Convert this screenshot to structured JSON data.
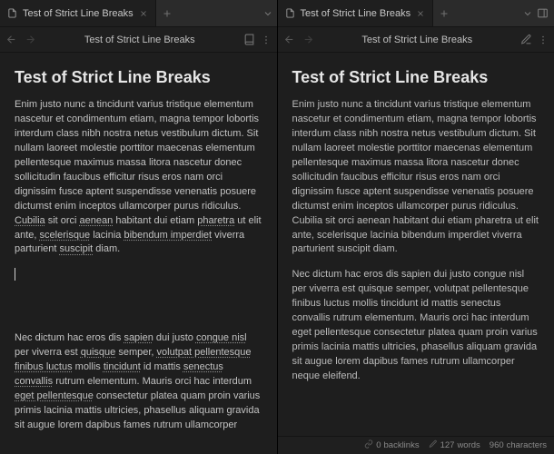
{
  "left": {
    "tab_title": "Test of Strict Line Breaks",
    "toolbar_title": "Test of Strict Line Breaks",
    "heading": "Test of Strict Line Breaks",
    "p1_pre": "Enim justo nunc a tincidunt varius tristique elementum nascetur et condimentum etiam, magna tempor lobortis interdum class nibh nostra netus vestibulum dictum. Sit nullam laoreet molestie porttitor maecenas elementum pellentesque maximus massa litora nascetur donec sollicitudin faucibus efficitur risus eros nam orci dignissim fusce aptent suspendisse venenatis posuere dictumst enim inceptos ullamcorper purus ridiculus. ",
    "p1_u1": "Cubilia",
    "p1_mid1": " sit orci ",
    "p1_u2": "aenean",
    "p1_mid2": " habitant dui etiam ",
    "p1_u3": "pharetra",
    "p1_mid3": " ut elit ante, ",
    "p1_u4": "scelerisque",
    "p1_mid4": " lacinia ",
    "p1_u5": "bibendum imperdiet",
    "p1_mid5": " viverra parturient ",
    "p1_u6": "suscipit",
    "p1_tail": " diam.",
    "p2_a": "Nec dictum hac eros dis ",
    "p2_u1": "sapien",
    "p2_b": " dui justo ",
    "p2_u2": "congue nisl",
    "p2_c": " per viverra est ",
    "p2_u3": "quisque",
    "p2_d": " semper, ",
    "p2_u4": "volutpat pellentesque",
    "p2_e": " ",
    "p2_u5": "finibus luctus",
    "p2_f": " mollis ",
    "p2_u6": "tincidunt",
    "p2_g": " id mattis ",
    "p2_u7": "senectus",
    "p2_h": " ",
    "p2_u8": "convallis",
    "p2_i": " rutrum elementum. Mauris orci hac interdum ",
    "p2_u9": "eget pellentesque",
    "p2_j": " consectetur platea quam proin varius primis lacinia mattis ultricies, phasellus aliquam gravida sit augue lorem dapibus fames rutrum ullamcorper"
  },
  "right": {
    "tab_title": "Test of Strict Line Breaks",
    "toolbar_title": "Test of Strict Line Breaks",
    "heading": "Test of Strict Line Breaks",
    "p1": "Enim justo nunc a tincidunt varius tristique elementum nascetur et condimentum etiam, magna tempor lobortis interdum class nibh nostra netus vestibulum dictum. Sit nullam laoreet molestie porttitor maecenas elementum pellentesque maximus massa litora nascetur donec sollicitudin faucibus efficitur risus eros nam orci dignissim fusce aptent suspendisse venenatis posuere dictumst enim inceptos ullamcorper purus ridiculus. Cubilia sit orci aenean habitant dui etiam pharetra ut elit ante, scelerisque lacinia bibendum imperdiet viverra parturient suscipit diam.",
    "p2": "Nec dictum hac eros dis sapien dui justo congue nisl per viverra est quisque semper, volutpat pellentesque finibus luctus mollis tincidunt id mattis senectus convallis rutrum elementum. Mauris orci hac interdum eget pellentesque consectetur platea quam proin varius primis lacinia mattis ultricies, phasellus aliquam gravida sit augue lorem dapibus fames rutrum ullamcorper neque eleifend."
  },
  "status": {
    "backlinks_count": "0",
    "backlinks_label": "backlinks",
    "words_count": "127",
    "words_label": "words",
    "chars_count": "960",
    "chars_label": "characters"
  }
}
